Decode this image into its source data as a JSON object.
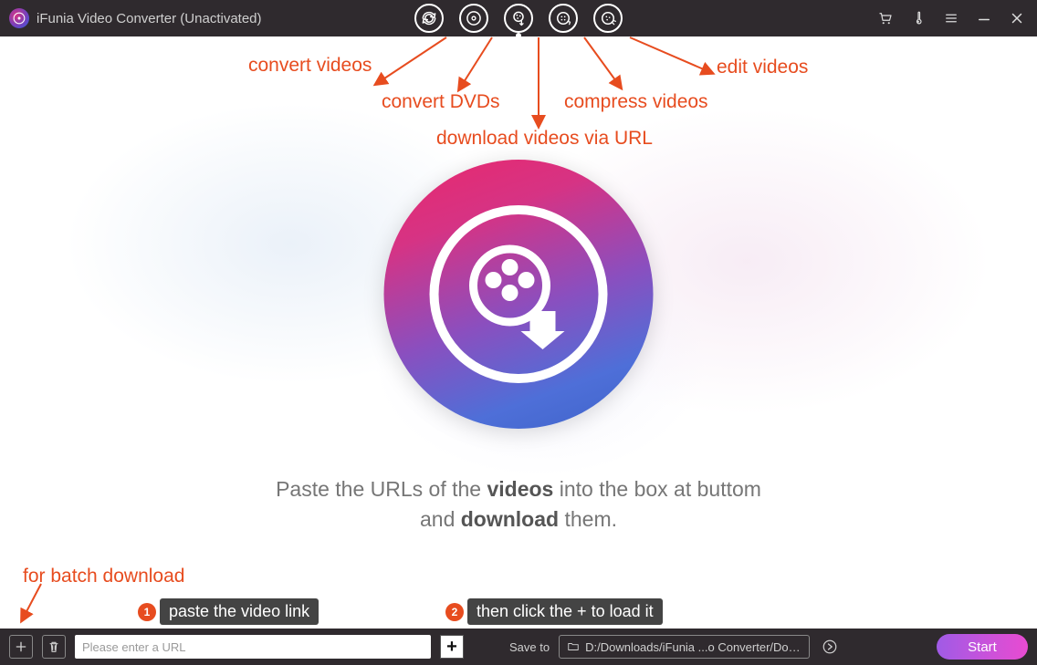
{
  "titlebar": {
    "app_icon_name": "app-icon",
    "title": "iFunia Video Converter (Unactivated)"
  },
  "modes": {
    "convert_video": "convert-video-icon",
    "convert_dvd": "convert-dvd-icon",
    "download": "download-icon",
    "compress": "compress-icon",
    "edit": "edit-icon",
    "active_index": 2
  },
  "right_controls": {
    "cart": "cart-icon",
    "thermometer": "thermometer-icon",
    "menu": "menu-icon",
    "minimize": "minimize-icon",
    "close": "close-icon"
  },
  "annotations": {
    "convert_videos": "convert videos",
    "convert_dvds": "convert DVDs",
    "download_via_url": "download videos via URL",
    "compress_videos": "compress videos",
    "edit_videos": "edit videos",
    "for_batch": "for batch download",
    "tip1_num": "1",
    "tip1_text": "paste the video link",
    "tip2_num": "2",
    "tip2_text": "then click the + to load it"
  },
  "instruction": {
    "pre1": "Paste the URLs of the ",
    "bold1": "videos",
    "mid1": " into the box at buttom",
    "line2_pre": "and ",
    "bold2": "download",
    "line2_post": " them."
  },
  "bottombar": {
    "add_file": "add-file-icon",
    "delete": "delete-icon",
    "url_placeholder": "Please enter a URL",
    "load_plus": "+",
    "save_to_label": "Save to",
    "folder_icon": "folder-icon",
    "save_path": "D:/Downloads/iFunia ...o Converter/Download",
    "go_arrow": "go-arrow-icon",
    "start_label": "Start"
  }
}
